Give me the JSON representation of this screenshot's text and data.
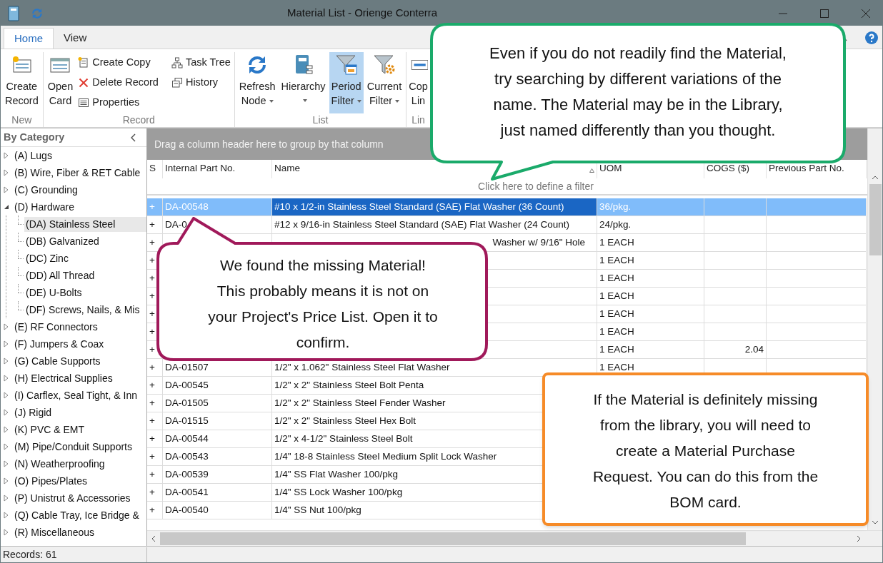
{
  "window": {
    "title": "Material List - Orienge Conterra"
  },
  "ribbon": {
    "tabs": [
      {
        "label": "Home",
        "selected": true
      },
      {
        "label": "View",
        "selected": false
      }
    ],
    "groups": [
      {
        "label": "New",
        "items": [
          {
            "kind": "large",
            "lines": [
              "Create",
              "Record"
            ]
          }
        ]
      },
      {
        "label": "Record",
        "items": [
          {
            "kind": "large",
            "lines": [
              "Open",
              "Card"
            ]
          },
          {
            "kind": "small",
            "lines": [
              "Create Copy"
            ]
          },
          {
            "kind": "small",
            "lines": [
              "Delete Record"
            ]
          },
          {
            "kind": "small",
            "lines": [
              "Properties"
            ]
          },
          {
            "kind": "small",
            "lines": [
              "Task Tree"
            ]
          },
          {
            "kind": "small",
            "lines": [
              "History"
            ]
          }
        ]
      },
      {
        "label": "List",
        "items": [
          {
            "kind": "large",
            "lines": [
              "Refresh",
              "Node"
            ],
            "dropdown": true,
            "on": false
          },
          {
            "kind": "large",
            "lines": [
              "Hierarchy"
            ],
            "dropdown": true,
            "on": false
          },
          {
            "kind": "large",
            "lines": [
              "Period",
              "Filter"
            ],
            "dropdown": true,
            "on": true
          },
          {
            "kind": "large",
            "lines": [
              "Current",
              "Filter"
            ],
            "dropdown": true,
            "on": false
          }
        ]
      },
      {
        "label": "Lin",
        "items": [
          {
            "kind": "large",
            "lines": [
              "Cop",
              "Lin"
            ]
          }
        ]
      }
    ]
  },
  "sidebar": {
    "title": "By Category",
    "tree": [
      {
        "label": "(A) Lugs",
        "expanded": false,
        "selected": false
      },
      {
        "label": "(B) Wire, Fiber & RET Cable",
        "expanded": false,
        "selected": false
      },
      {
        "label": "(C) Grounding",
        "expanded": false,
        "selected": false
      },
      {
        "label": "(D) Hardware",
        "expanded": true,
        "selected": false,
        "children": [
          {
            "label": "(DA) Stainless Steel",
            "selected": true
          },
          {
            "label": "(DB) Galvanized",
            "selected": false
          },
          {
            "label": "(DC) Zinc",
            "selected": false
          },
          {
            "label": "(DD) All Thread",
            "selected": false
          },
          {
            "label": "(DE) U-Bolts",
            "selected": false
          },
          {
            "label": "(DF) Screws, Nails, & Mis",
            "selected": false
          }
        ]
      },
      {
        "label": "(E) RF Connectors",
        "expanded": false,
        "selected": false
      },
      {
        "label": "(F) Jumpers & Coax",
        "expanded": false,
        "selected": false
      },
      {
        "label": "(G) Cable Supports",
        "expanded": false,
        "selected": false
      },
      {
        "label": "(H) Electrical Supplies",
        "expanded": false,
        "selected": false
      },
      {
        "label": "(I) Carflex, Seal Tight, & Inn",
        "expanded": false,
        "selected": false
      },
      {
        "label": "(J) Rigid",
        "expanded": false,
        "selected": false
      },
      {
        "label": "(K) PVC & EMT",
        "expanded": false,
        "selected": false
      },
      {
        "label": "(M) Pipe/Conduit Supports",
        "expanded": false,
        "selected": false
      },
      {
        "label": "(N) Weatherproofing",
        "expanded": false,
        "selected": false
      },
      {
        "label": "(O) Pipes/Plates",
        "expanded": false,
        "selected": false
      },
      {
        "label": "(P) Unistrut & Accessories",
        "expanded": false,
        "selected": false
      },
      {
        "label": "(Q) Cable Tray, Ice Bridge &",
        "expanded": false,
        "selected": false
      },
      {
        "label": "(R) Miscellaneous",
        "expanded": false,
        "selected": false
      }
    ]
  },
  "grid": {
    "group_panel": "Drag a column header here to group by that column",
    "columns": [
      {
        "label": "S",
        "sorted": false
      },
      {
        "label": "Internal Part No.",
        "sorted": false
      },
      {
        "label": "Name",
        "sorted": true
      },
      {
        "label": "UOM",
        "sorted": false
      },
      {
        "label": "COGS ($)",
        "sorted": false
      },
      {
        "label": "Previous Part No.",
        "sorted": false
      }
    ],
    "filter_hint": "Click here to define a filter",
    "rows": [
      {
        "expander": "+",
        "part_no": "DA-00548",
        "name": "#10 x 1/2-in Stainless Steel Standard (SAE) Flat Washer (36 Count)",
        "uom": "36/pkg.",
        "selected": true
      },
      {
        "expander": "+",
        "part_no": "DA-0",
        "name": "#12 x 9/16-in Stainless Steel Standard (SAE) Flat Washer (24 Count)",
        "uom": "24/pkg.",
        "selected": false
      },
      {
        "expander": "+",
        "name": "Washer w/ 9/16\" Hole",
        "name_clipped": true,
        "uom": "1 EACH",
        "selected": false
      },
      {
        "expander": "+",
        "uom": "1 EACH",
        "selected": false
      },
      {
        "expander": "+",
        "uom": "1 EACH",
        "selected": false
      },
      {
        "expander": "+",
        "uom": "1 EACH",
        "selected": false
      },
      {
        "expander": "+",
        "uom": "1 EACH",
        "selected": false
      },
      {
        "expander": "+",
        "uom": "1 EACH",
        "selected": false
      },
      {
        "expander": "+",
        "uom": "1 EACH",
        "cogs": "2.04",
        "selected": false
      },
      {
        "expander": "+",
        "part_no": "DA-01507",
        "name": "1/2\" x 1.062\" Stainless Steel Flat Washer",
        "uom": "1 EACH",
        "selected": false
      },
      {
        "expander": "+",
        "part_no": "DA-00545",
        "name": "1/2\" x 2\" Stainless Steel Bolt Penta",
        "selected": false
      },
      {
        "expander": "+",
        "part_no": "DA-01505",
        "name": "1/2\" x 2\" Stainless Steel Fender Washer",
        "selected": false
      },
      {
        "expander": "+",
        "part_no": "DA-01515",
        "name": "1/2\" x 2\" Stainless Steel Hex Bolt",
        "selected": false
      },
      {
        "expander": "+",
        "part_no": "DA-00544",
        "name": "1/2\" x 4-1/2\" Stainless Steel Bolt",
        "selected": false
      },
      {
        "expander": "+",
        "part_no": "DA-00543",
        "name": "1/4\" 18-8 Stainless Steel Medium Split Lock Washer",
        "selected": false
      },
      {
        "expander": "+",
        "part_no": "DA-00539",
        "name": "1/4\" SS Flat Washer 100/pkg",
        "selected": false
      },
      {
        "expander": "+",
        "part_no": "DA-00541",
        "name": "1/4\" SS Lock Washer 100/pkg",
        "selected": false
      },
      {
        "expander": "+",
        "part_no": "DA-00540",
        "name": "1/4\" SS Nut 100/pkg",
        "selected": false
      }
    ]
  },
  "status_bar": {
    "records": "Records: 61"
  },
  "callouts": [
    {
      "kind": "tail-down",
      "color": "#1aaa6a",
      "lines": [
        "Even if you do not readily find the Material,",
        "try searching by different variations of the",
        "name. The Material may be in the Library,",
        "just named differently than you thought."
      ]
    },
    {
      "kind": "tail-up",
      "color": "#a0195a",
      "lines": [
        "We found the missing Material!",
        "This probably means it is not on",
        "your Project's Price List. Open it to",
        "confirm."
      ]
    },
    {
      "kind": "plain",
      "color": "#f68b28",
      "lines": [
        "If the Material is definitely missing",
        "from the library, you will need to",
        "create a Material Purchase",
        "Request. You can do this from the",
        "BOM card."
      ]
    }
  ]
}
